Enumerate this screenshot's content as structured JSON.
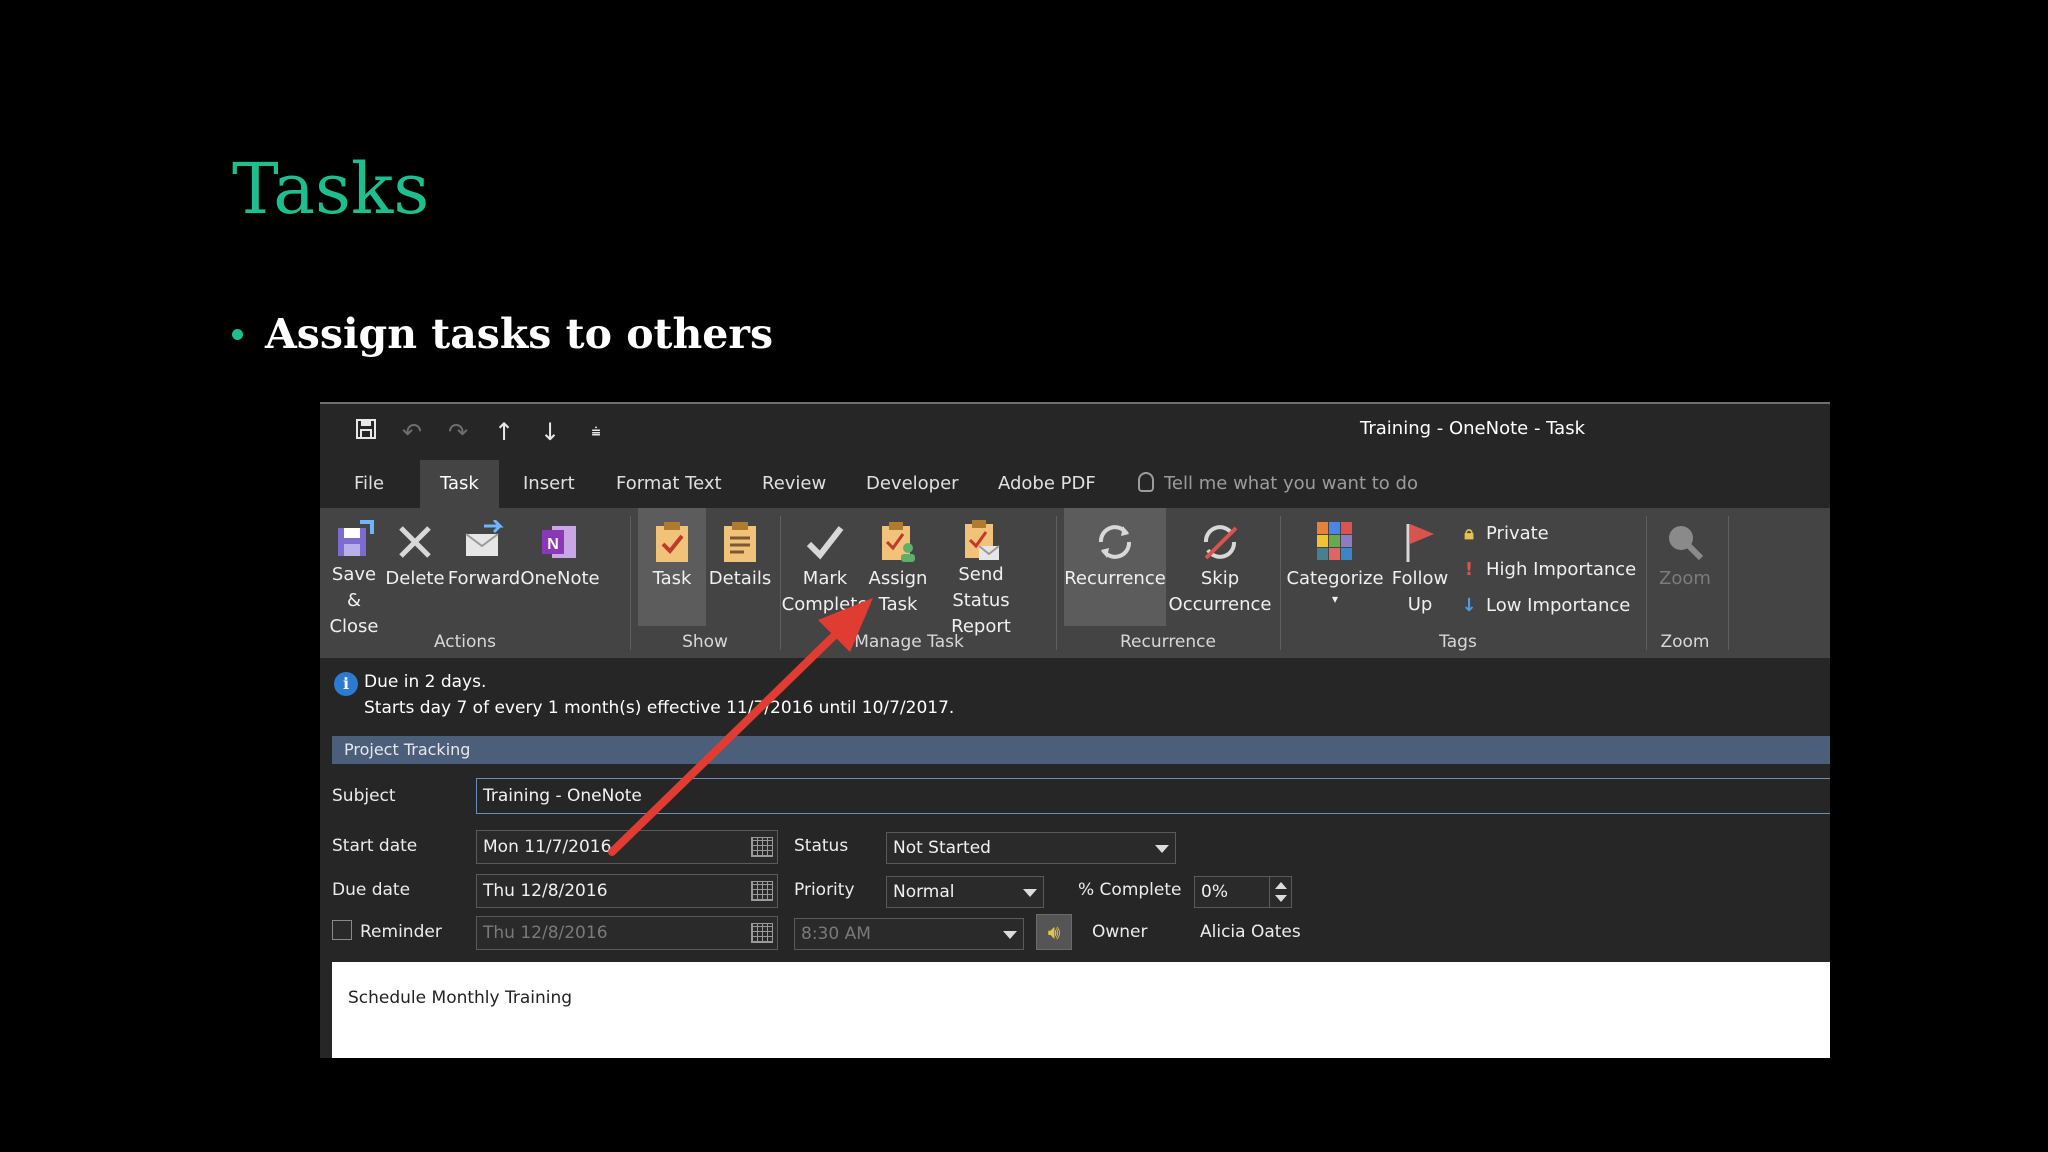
{
  "slide": {
    "title": "Tasks",
    "bullet": "Assign tasks to others"
  },
  "window": {
    "title": "Training - OneNote - Task"
  },
  "tabs": [
    "File",
    "Task",
    "Insert",
    "Format Text",
    "Review",
    "Developer",
    "Adobe PDF"
  ],
  "active_tab": "Task",
  "tell_me": "Tell me what you want to do",
  "ribbon": {
    "actions": {
      "label": "Actions",
      "save_close": "Save &\nClose",
      "delete": "Delete",
      "forward": "Forward",
      "onenote": "OneNote"
    },
    "show": {
      "label": "Show",
      "task": "Task",
      "details": "Details"
    },
    "manage_task": {
      "label": "Manage Task",
      "mark_complete": "Mark\nComplete",
      "assign_task": "Assign\nTask",
      "send_status": "Send Status\nReport"
    },
    "recurrence": {
      "label": "Recurrence",
      "recurrence": "Recurrence",
      "skip": "Skip\nOccurrence"
    },
    "tags": {
      "label": "Tags",
      "categorize": "Categorize",
      "follow_up": "Follow\nUp",
      "private": "Private",
      "high": "High Importance",
      "low": "Low Importance"
    },
    "zoom": {
      "label": "Zoom",
      "zoom": "Zoom"
    }
  },
  "info": {
    "line1": "Due in 2 days.",
    "line2": "Starts day 7 of every 1 month(s) effective 11/7/2016 until 10/7/2017."
  },
  "project_tracking": "Project Tracking",
  "form": {
    "subject_label": "Subject",
    "subject_value": "Training - OneNote",
    "start_label": "Start date",
    "start_value": "Mon 11/7/2016",
    "due_label": "Due date",
    "due_value": "Thu 12/8/2016",
    "reminder_label": "Reminder",
    "reminder_date": "Thu 12/8/2016",
    "reminder_time": "8:30 AM",
    "status_label": "Status",
    "status_value": "Not Started",
    "priority_label": "Priority",
    "priority_value": "Normal",
    "complete_label": "% Complete",
    "complete_value": "0%",
    "owner_label": "Owner",
    "owner_value": "Alicia Oates"
  },
  "notes": "Schedule Monthly Training",
  "colors": {
    "accent": "#1dbf8f",
    "arrow": "#e03c31",
    "ribbon": "#444444",
    "app_bg": "#262626"
  }
}
